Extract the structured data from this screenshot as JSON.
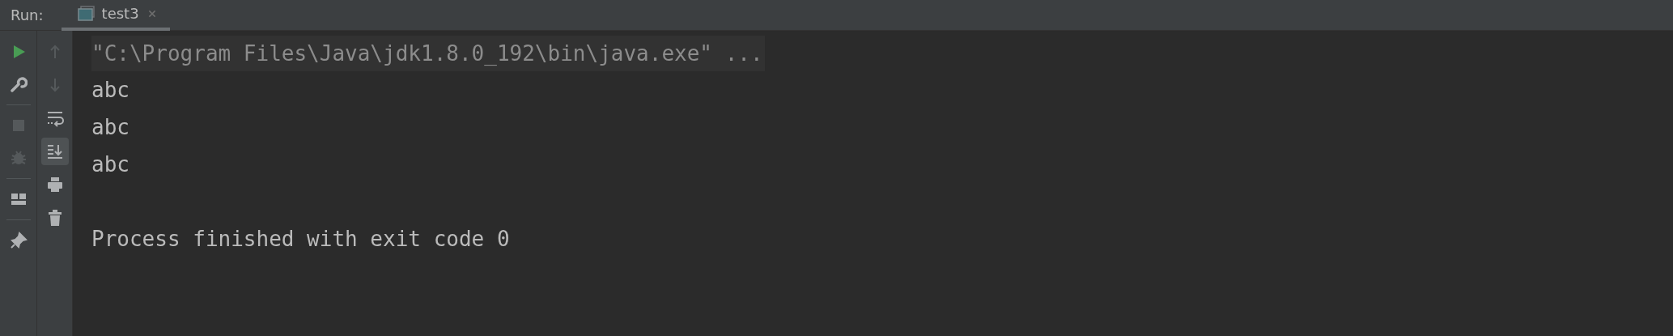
{
  "header": {
    "label": "Run:",
    "tab": {
      "title": "test3",
      "selected": true
    }
  },
  "toolbar_main": [
    {
      "kind": "run",
      "disabled": false
    },
    {
      "kind": "wrench",
      "disabled": false
    },
    {
      "kind": "divider"
    },
    {
      "kind": "stop",
      "disabled": true
    },
    {
      "kind": "debug",
      "disabled": true
    },
    {
      "kind": "divider"
    },
    {
      "kind": "layout",
      "disabled": false
    },
    {
      "kind": "divider"
    },
    {
      "kind": "pin",
      "disabled": false
    }
  ],
  "toolbar_console": [
    {
      "kind": "up",
      "disabled": true,
      "selected": false
    },
    {
      "kind": "down",
      "disabled": true,
      "selected": false
    },
    {
      "kind": "wrap",
      "disabled": false,
      "selected": false
    },
    {
      "kind": "scroll-end",
      "disabled": false,
      "selected": true
    },
    {
      "kind": "print",
      "disabled": false,
      "selected": false
    },
    {
      "kind": "trash",
      "disabled": false,
      "selected": false
    }
  ],
  "console": [
    {
      "kind": "command",
      "text": "\"C:\\Program Files\\Java\\jdk1.8.0_192\\bin\\java.exe\" ..."
    },
    {
      "kind": "output",
      "text": "abc"
    },
    {
      "kind": "output",
      "text": "abc"
    },
    {
      "kind": "output",
      "text": "abc"
    },
    {
      "kind": "exit",
      "text": "Process finished with exit code 0"
    }
  ]
}
